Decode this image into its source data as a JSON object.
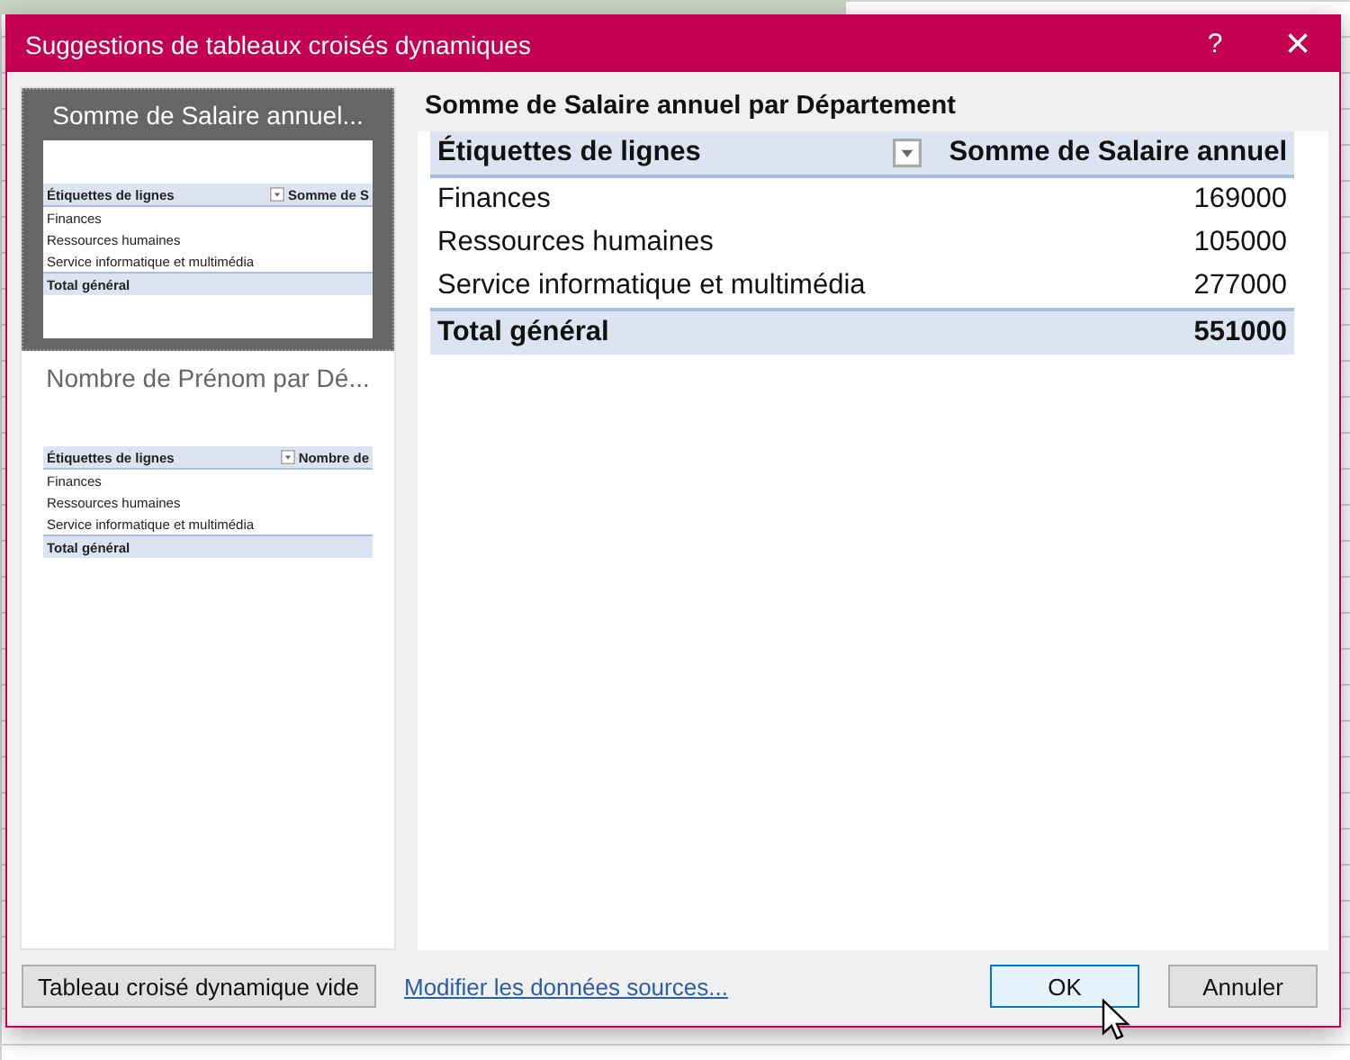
{
  "window": {
    "title": "Suggestions de tableaux croisés dynamiques",
    "help": "?",
    "close": "×"
  },
  "suggestions": [
    {
      "title": "Somme de Salaire annuel...",
      "selected": true,
      "thumbnail": {
        "header": [
          "Étiquettes de lignes",
          "Somme de S"
        ],
        "rows": [
          "Finances",
          "Ressources humaines",
          "Service informatique et multimédia"
        ],
        "total": "Total général"
      }
    },
    {
      "title": "Nombre de Prénom par Dé...",
      "selected": false,
      "thumbnail": {
        "header": [
          "Étiquettes de lignes",
          "Nombre de"
        ],
        "rows": [
          "Finances",
          "Ressources humaines",
          "Service informatique et multimédia"
        ],
        "total": "Total général"
      }
    }
  ],
  "preview": {
    "title": "Somme de Salaire annuel par Département",
    "columns": [
      "Étiquettes de lignes",
      "Somme de Salaire annuel"
    ],
    "rows": [
      {
        "label": "Finances",
        "value": "169000"
      },
      {
        "label": "Ressources humaines",
        "value": "105000"
      },
      {
        "label": "Service informatique et multimédia",
        "value": "277000"
      }
    ],
    "total": {
      "label": "Total général",
      "value": "551000"
    }
  },
  "footer": {
    "blank_button": "Tableau croisé dynamique vide",
    "link": "Modifier les données sources...",
    "ok": "OK",
    "cancel": "Annuler"
  }
}
